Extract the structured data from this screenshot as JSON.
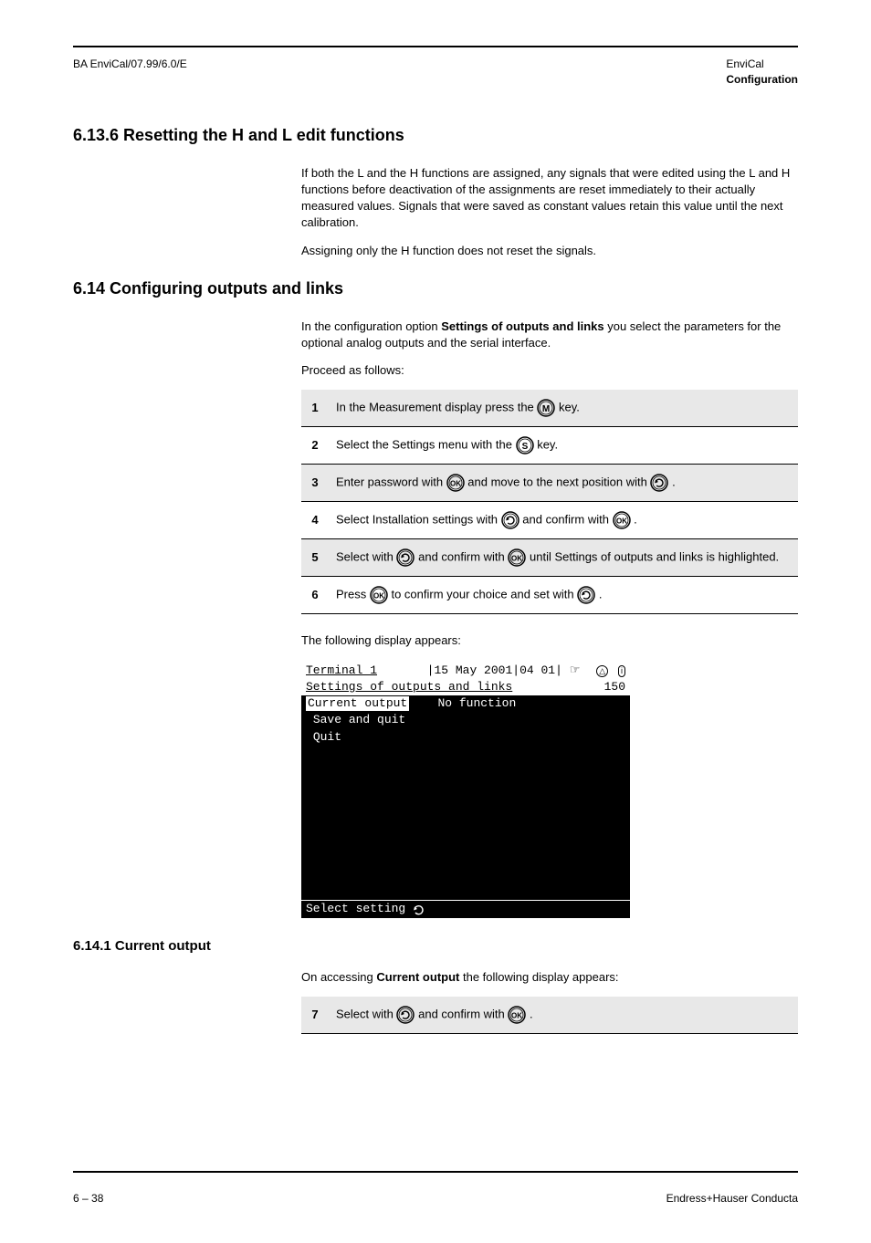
{
  "header": {
    "left": "BA EnviCal/07.99/6.0/E",
    "right": "EnviCal",
    "page_title_right": "Configuration"
  },
  "s1": {
    "title": "6.13.6 Resetting the H and L edit functions",
    "p1": "If both the L and the H functions are assigned, any signals that were edited using the L and H functions before deactivation of the assignments are reset immediately to their actually measured values. Signals that were saved as constant values retain this value until the next calibration.",
    "p2": "Assigning only the H function does not reset the signals."
  },
  "s2": {
    "title": "6.14 Configuring outputs and links",
    "p1_a": "In the configuration option ",
    "p1_b": "Settings of outputs and links",
    "p1_c": " you select the parameters for the optional analog outputs and the serial interface.",
    "proceed": "Proceed as follows:"
  },
  "steps1": [
    {
      "n": "1",
      "t_before": "In the Measurement display press the ",
      "t_after": " key."
    },
    {
      "n": "2",
      "t_before": "Select the Settings menu with the ",
      "t_after": " key."
    },
    {
      "n": "3",
      "t_before": "Enter password with ",
      "t_mid": " and move to the next position with ",
      "t_after": "."
    },
    {
      "n": "4",
      "t_before": "Select Installation settings with ",
      "t_mid": " and confirm with ",
      "t_after": "."
    },
    {
      "n": "5",
      "t_before": "Select with ",
      "t_mid": " and confirm with ",
      "t_after": " until Settings of outputs and links is highlighted."
    },
    {
      "n": "6",
      "t_before": "Press ",
      "t_mid": " to confirm your choice and set with ",
      "t_after": "."
    }
  ],
  "after_steps1": "The following display appears:",
  "terminal": {
    "title": "Terminal 1",
    "date": "15 May  2001",
    "clock": "04 01",
    "subtitle_left": "Settings of outputs and links",
    "subtitle_right": "150",
    "row_label": "Current output",
    "row_value": "No function",
    "item2": "Save and quit",
    "item3": "Quit",
    "footer": "Select setting"
  },
  "s3": {
    "title": "6.14.1 Current output",
    "p_before": "On accessing ",
    "p_b": "Current output",
    "p_after": " the following display appears:"
  },
  "steps2": [
    {
      "n": "7",
      "t_before": "Select with ",
      "t_mid": " and confirm with ",
      "t_after": "."
    }
  ],
  "footer": {
    "left": "6 – 38",
    "right": "Endress+Hauser Conducta"
  }
}
